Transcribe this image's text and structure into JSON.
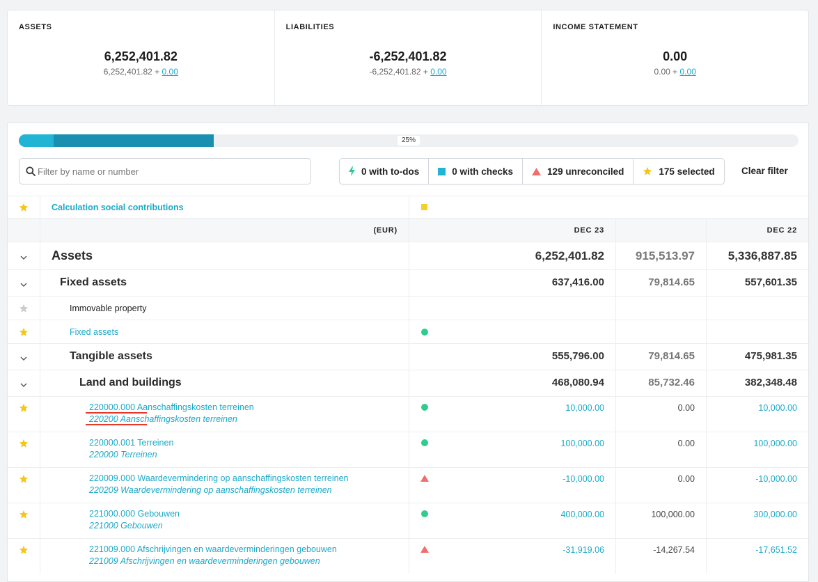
{
  "summary": [
    {
      "title": "ASSETS",
      "value": "6,252,401.82",
      "base": "6,252,401.82 + ",
      "delta": "0.00"
    },
    {
      "title": "LIABILITIES",
      "value": "-6,252,401.82",
      "base": "-6,252,401.82 + ",
      "delta": "0.00"
    },
    {
      "title": "INCOME STATEMENT",
      "value": "0.00",
      "base": "0.00 + ",
      "delta": "0.00"
    }
  ],
  "progress": {
    "label": "25%",
    "fraction": 0.25,
    "primary_fraction": 0.045,
    "colors": {
      "light": "#22b4d4",
      "dark": "#1a8fb0"
    }
  },
  "search": {
    "placeholder": "Filter by name or number",
    "value": ""
  },
  "filters": [
    {
      "label": "0 with to-dos",
      "icon": "lightning-icon"
    },
    {
      "label": "0 with checks",
      "icon": "square-icon"
    },
    {
      "label": "129 unreconciled",
      "icon": "triangle-icon"
    },
    {
      "label": "175 selected",
      "icon": "star-icon"
    }
  ],
  "clear_filter": "Clear filter",
  "calc_row": {
    "label": "Calculation social contributions"
  },
  "header": {
    "currency": "(EUR)",
    "col1": "DEC 23",
    "col3": "DEC 22"
  },
  "rows": [
    {
      "type": "group",
      "level": 0,
      "label": "Assets",
      "v1": "6,252,401.82",
      "v2": "915,513.97",
      "v3": "5,336,887.85"
    },
    {
      "type": "group",
      "level": 1,
      "label": "Fixed assets",
      "v1": "637,416.00",
      "v2": "79,814.65",
      "v3": "557,601.35"
    },
    {
      "type": "plain",
      "label": "Immovable property"
    },
    {
      "type": "linkrow",
      "label": "Fixed assets"
    },
    {
      "type": "group",
      "level": 2,
      "label": "Tangible assets",
      "v1": "555,796.00",
      "v2": "79,814.65",
      "v3": "475,981.35"
    },
    {
      "type": "group",
      "level": 3,
      "label": "Land and buildings",
      "v1": "468,080.94",
      "v2": "85,732.46",
      "v3": "382,348.48"
    },
    {
      "type": "account",
      "status": "dot",
      "label": "220000.000 Aanschaffingskosten terreinen",
      "sub": "220200 Aanschaffingskosten terreinen",
      "v1": "10,000.00",
      "v2": "0.00",
      "v3": "10,000.00"
    },
    {
      "type": "account",
      "status": "dot",
      "label": "220000.001 Terreinen",
      "sub": "220000 Terreinen",
      "v1": "100,000.00",
      "v2": "0.00",
      "v3": "100,000.00"
    },
    {
      "type": "account",
      "status": "tri",
      "label": "220009.000 Waardevermindering op aanschaffingskosten terreinen",
      "sub": "220209 Waardevermindering op aanschaffingskosten terreinen",
      "v1": "-10,000.00",
      "v2": "0.00",
      "v3": "-10,000.00"
    },
    {
      "type": "account",
      "status": "dot",
      "label": "221000.000 Gebouwen",
      "sub": "221000 Gebouwen",
      "v1": "400,000.00",
      "v2": "100,000.00",
      "v3": "300,000.00"
    },
    {
      "type": "account",
      "status": "tri",
      "label": "221009.000 Afschrijvingen en waardeverminderingen gebouwen",
      "sub": "221009 Afschrijvingen en waardeverminderingen gebouwen",
      "v1": "-31,919.06",
      "v2": "-14,267.54",
      "v3": "-17,651.52"
    }
  ],
  "colors": {
    "accent": "#1ba9c9",
    "star": "#f5c518",
    "star_off": "#c9cdd2",
    "ok": "#2ecc8f",
    "warn": "#ef6f6f",
    "marker": "#e8382a"
  }
}
